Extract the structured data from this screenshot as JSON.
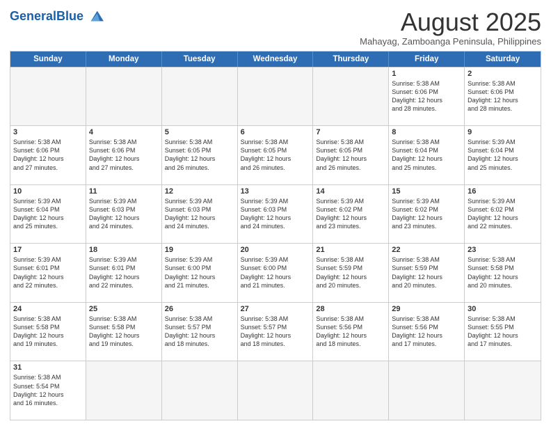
{
  "header": {
    "logo_general": "General",
    "logo_blue": "Blue",
    "month_year": "August 2025",
    "location": "Mahayag, Zamboanga Peninsula, Philippines"
  },
  "days_of_week": [
    "Sunday",
    "Monday",
    "Tuesday",
    "Wednesday",
    "Thursday",
    "Friday",
    "Saturday"
  ],
  "weeks": [
    [
      {
        "day": "",
        "info": ""
      },
      {
        "day": "",
        "info": ""
      },
      {
        "day": "",
        "info": ""
      },
      {
        "day": "",
        "info": ""
      },
      {
        "day": "",
        "info": ""
      },
      {
        "day": "1",
        "info": "Sunrise: 5:38 AM\nSunset: 6:06 PM\nDaylight: 12 hours\nand 28 minutes."
      },
      {
        "day": "2",
        "info": "Sunrise: 5:38 AM\nSunset: 6:06 PM\nDaylight: 12 hours\nand 28 minutes."
      }
    ],
    [
      {
        "day": "3",
        "info": "Sunrise: 5:38 AM\nSunset: 6:06 PM\nDaylight: 12 hours\nand 27 minutes."
      },
      {
        "day": "4",
        "info": "Sunrise: 5:38 AM\nSunset: 6:06 PM\nDaylight: 12 hours\nand 27 minutes."
      },
      {
        "day": "5",
        "info": "Sunrise: 5:38 AM\nSunset: 6:05 PM\nDaylight: 12 hours\nand 26 minutes."
      },
      {
        "day": "6",
        "info": "Sunrise: 5:38 AM\nSunset: 6:05 PM\nDaylight: 12 hours\nand 26 minutes."
      },
      {
        "day": "7",
        "info": "Sunrise: 5:38 AM\nSunset: 6:05 PM\nDaylight: 12 hours\nand 26 minutes."
      },
      {
        "day": "8",
        "info": "Sunrise: 5:38 AM\nSunset: 6:04 PM\nDaylight: 12 hours\nand 25 minutes."
      },
      {
        "day": "9",
        "info": "Sunrise: 5:39 AM\nSunset: 6:04 PM\nDaylight: 12 hours\nand 25 minutes."
      }
    ],
    [
      {
        "day": "10",
        "info": "Sunrise: 5:39 AM\nSunset: 6:04 PM\nDaylight: 12 hours\nand 25 minutes."
      },
      {
        "day": "11",
        "info": "Sunrise: 5:39 AM\nSunset: 6:03 PM\nDaylight: 12 hours\nand 24 minutes."
      },
      {
        "day": "12",
        "info": "Sunrise: 5:39 AM\nSunset: 6:03 PM\nDaylight: 12 hours\nand 24 minutes."
      },
      {
        "day": "13",
        "info": "Sunrise: 5:39 AM\nSunset: 6:03 PM\nDaylight: 12 hours\nand 24 minutes."
      },
      {
        "day": "14",
        "info": "Sunrise: 5:39 AM\nSunset: 6:02 PM\nDaylight: 12 hours\nand 23 minutes."
      },
      {
        "day": "15",
        "info": "Sunrise: 5:39 AM\nSunset: 6:02 PM\nDaylight: 12 hours\nand 23 minutes."
      },
      {
        "day": "16",
        "info": "Sunrise: 5:39 AM\nSunset: 6:02 PM\nDaylight: 12 hours\nand 22 minutes."
      }
    ],
    [
      {
        "day": "17",
        "info": "Sunrise: 5:39 AM\nSunset: 6:01 PM\nDaylight: 12 hours\nand 22 minutes."
      },
      {
        "day": "18",
        "info": "Sunrise: 5:39 AM\nSunset: 6:01 PM\nDaylight: 12 hours\nand 22 minutes."
      },
      {
        "day": "19",
        "info": "Sunrise: 5:39 AM\nSunset: 6:00 PM\nDaylight: 12 hours\nand 21 minutes."
      },
      {
        "day": "20",
        "info": "Sunrise: 5:39 AM\nSunset: 6:00 PM\nDaylight: 12 hours\nand 21 minutes."
      },
      {
        "day": "21",
        "info": "Sunrise: 5:38 AM\nSunset: 5:59 PM\nDaylight: 12 hours\nand 20 minutes."
      },
      {
        "day": "22",
        "info": "Sunrise: 5:38 AM\nSunset: 5:59 PM\nDaylight: 12 hours\nand 20 minutes."
      },
      {
        "day": "23",
        "info": "Sunrise: 5:38 AM\nSunset: 5:58 PM\nDaylight: 12 hours\nand 20 minutes."
      }
    ],
    [
      {
        "day": "24",
        "info": "Sunrise: 5:38 AM\nSunset: 5:58 PM\nDaylight: 12 hours\nand 19 minutes."
      },
      {
        "day": "25",
        "info": "Sunrise: 5:38 AM\nSunset: 5:58 PM\nDaylight: 12 hours\nand 19 minutes."
      },
      {
        "day": "26",
        "info": "Sunrise: 5:38 AM\nSunset: 5:57 PM\nDaylight: 12 hours\nand 18 minutes."
      },
      {
        "day": "27",
        "info": "Sunrise: 5:38 AM\nSunset: 5:57 PM\nDaylight: 12 hours\nand 18 minutes."
      },
      {
        "day": "28",
        "info": "Sunrise: 5:38 AM\nSunset: 5:56 PM\nDaylight: 12 hours\nand 18 minutes."
      },
      {
        "day": "29",
        "info": "Sunrise: 5:38 AM\nSunset: 5:56 PM\nDaylight: 12 hours\nand 17 minutes."
      },
      {
        "day": "30",
        "info": "Sunrise: 5:38 AM\nSunset: 5:55 PM\nDaylight: 12 hours\nand 17 minutes."
      }
    ],
    [
      {
        "day": "31",
        "info": "Sunrise: 5:38 AM\nSunset: 5:54 PM\nDaylight: 12 hours\nand 16 minutes."
      },
      {
        "day": "",
        "info": ""
      },
      {
        "day": "",
        "info": ""
      },
      {
        "day": "",
        "info": ""
      },
      {
        "day": "",
        "info": ""
      },
      {
        "day": "",
        "info": ""
      },
      {
        "day": "",
        "info": ""
      }
    ]
  ]
}
